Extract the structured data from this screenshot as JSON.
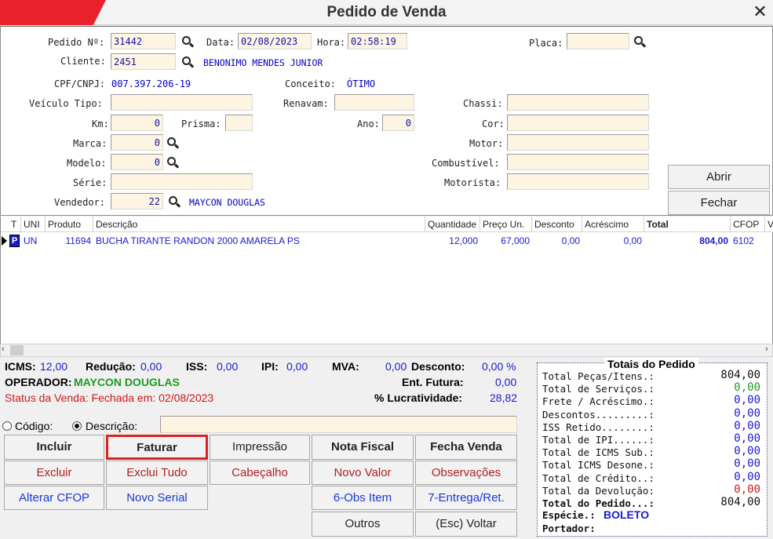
{
  "window": {
    "title": "Pedido de Venda",
    "close_glyph": "✕"
  },
  "header": {
    "pedido_label": "Pedido Nº:",
    "pedido_value": "31442",
    "data_label": "Data:",
    "data_value": "02/08/2023",
    "hora_label": "Hora:",
    "hora_value": "02:58:19",
    "placa_label": "Placa:",
    "placa_value": "",
    "cliente_label": "Cliente:",
    "cliente_value": "2451",
    "cliente_name": "BENONIMO MENDES JUNIOR",
    "cpf_label": "CPF/CNPJ:",
    "cpf_value": "007.397.206-19",
    "conceito_label": "Conceito:",
    "conceito_value": "ÓTIMO",
    "veiculo_tipo_label": "Veículo Tipo:",
    "veiculo_tipo_value": "",
    "renavam_label": "Renavam:",
    "renavam_value": "",
    "chassi_label": "Chassi:",
    "chassi_value": "",
    "km_label": "Km:",
    "km_value": "0",
    "prisma_label": "Prisma:",
    "prisma_value": "",
    "ano_label": "Ano:",
    "ano_value": "0",
    "cor_label": "Cor:",
    "cor_value": "",
    "marca_label": "Marca:",
    "marca_value": "0",
    "motor_label": "Motor:",
    "motor_value": "",
    "modelo_label": "Modelo:",
    "modelo_value": "0",
    "combustivel_label": "Combustível:",
    "combustivel_value": "",
    "serie_label": "Série:",
    "serie_value": "",
    "motorista_label": "Motorista:",
    "motorista_value": "",
    "vendedor_label": "Vendedor:",
    "vendedor_value": "22",
    "vendedor_name": "MAYCON DOUGLAS",
    "abrir_label": "Abrir",
    "fechar_label": "Fechar"
  },
  "grid": {
    "columns": [
      "T",
      "UNI",
      "Produto",
      "Descrição",
      "Quantidade",
      "Preço Un.",
      "Desconto",
      "Acréscimo",
      "Total",
      "CFOP",
      "V"
    ],
    "rows": [
      {
        "t": "P",
        "uni": "UN",
        "produto": "11694",
        "descricao": "BUCHA TIRANTE RANDON 2000 AMARELA PS",
        "quantidade": "12,000",
        "preco": "67,000",
        "desconto": "0,00",
        "acrescimo": "0,00",
        "total": "804,00",
        "cfop": "6102"
      }
    ]
  },
  "summary": {
    "icms_label": "ICMS:",
    "icms_value": "12,00",
    "reducao_label": "Redução:",
    "reducao_value": "0,00",
    "iss_label": "ISS:",
    "iss_value": "0,00",
    "ipi_label": "IPI:",
    "ipi_value": "0,00",
    "mva_label": "MVA:",
    "mva_value": "0,00",
    "desconto_label": "Desconto:",
    "desconto_value": "0,00 %",
    "operador_label": "OPERADOR:",
    "operador_value": "MAYCON DOUGLAS",
    "ent_futura_label": "Ent. Futura:",
    "ent_futura_value": "0,00",
    "status_text": "Status da Venda: Fechada em: 02/08/2023",
    "lucratividade_label": "% Lucratividade:",
    "lucratividade_value": "28,82"
  },
  "search": {
    "codigo_label": "Código:",
    "descricao_label": "Descrição:",
    "selected": "descricao",
    "value": ""
  },
  "buttons": {
    "incluir": "Incluir",
    "faturar": "Faturar",
    "impressao": "Impressão",
    "nota_fiscal": "Nota Fiscal",
    "fecha_venda": "Fecha Venda",
    "excluir": "Excluir",
    "exclui_tudo": "Exclui Tudo",
    "cabecalho": "Cabeçalho",
    "novo_valor": "Novo Valor",
    "observacoes": "Observações",
    "alterar_cfop": "Alterar CFOP",
    "novo_serial": "Novo Serial",
    "obs_item": "6-Obs Item",
    "entrega_ret": "7-Entrega/Ret.",
    "outros": "Outros",
    "voltar": "(Esc) Voltar"
  },
  "totals": {
    "title": "Totais do Pedido",
    "rows": [
      {
        "label": "Total Peças/Itens.:",
        "value": "804,00",
        "color": "#111111"
      },
      {
        "label": "Total de Serviços.:",
        "value": "0,00",
        "color": "#1f9a1f"
      },
      {
        "label": "Frete / Acréscimo.:",
        "value": "0,00",
        "color": "#1a1ad0"
      },
      {
        "label": "Descontos.........:",
        "value": "0,00",
        "color": "#1a1ad0"
      },
      {
        "label": "ISS Retido........:",
        "value": "0,00",
        "color": "#1a1ad0"
      },
      {
        "label": "Total de IPI......:",
        "value": "0,00",
        "color": "#1a1ad0"
      },
      {
        "label": "Total de ICMS Sub.:",
        "value": "0,00",
        "color": "#1a1ad0"
      },
      {
        "label": "Total ICMS Desone.:",
        "value": "0,00",
        "color": "#1a1ad0"
      },
      {
        "label": "Total de Crédito..:",
        "value": "0,00",
        "color": "#1a1ad0"
      },
      {
        "label": "Total da Devolução:",
        "value": "0,00",
        "color": "#d01818"
      },
      {
        "label": "Total do Pedido...:",
        "value": "804,00",
        "color": "#111111"
      }
    ],
    "especie_label": "Espécie.:",
    "especie_value": "BOLETO",
    "portador_label": "Portador:",
    "portador_value": ""
  },
  "colors": {
    "accent_red": "#e8212a",
    "field_bg": "#fdf5e2",
    "value_blue": "#1a1ad0",
    "highlight_border": "#e02020"
  }
}
